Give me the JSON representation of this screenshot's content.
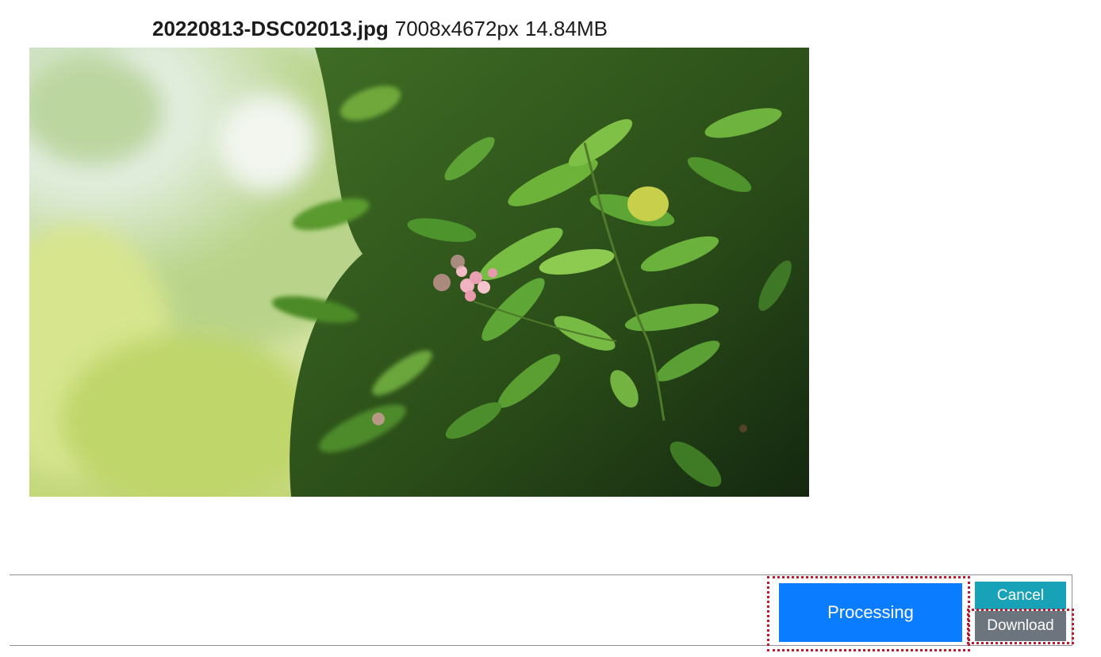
{
  "header": {
    "filename": "20220813-DSC02013.jpg",
    "dimensions": "7008x4672px",
    "filesize": "14.84MB"
  },
  "photo": {
    "subject": "green leafy shrub with small pink lantana flowers, blurred bright background"
  },
  "actions": {
    "processing_label": "Processing",
    "cancel_label": "Cancel",
    "download_label": "Download"
  },
  "colors": {
    "processing": "#0a7cff",
    "cancel": "#17a2b8",
    "download": "#6c757d",
    "highlight_outline": "#c0182c"
  }
}
